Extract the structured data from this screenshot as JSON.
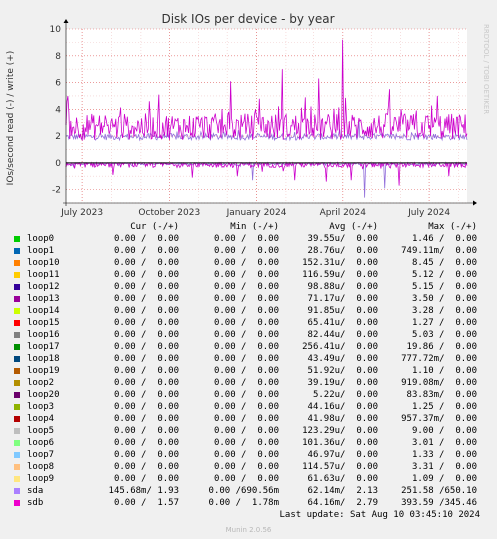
{
  "colors": {
    "background": "#f0f0f0",
    "plot_background": "#ffffff",
    "grid": "#e06060",
    "read_line": "#000000"
  },
  "chart_data": {
    "type": "line",
    "title": "Disk IOs per device - by year",
    "ylabel": "IOs/second read (-) / write (+)",
    "ylim": [
      -3,
      10
    ],
    "yticks": [
      -2,
      0,
      2,
      4,
      6,
      8,
      10
    ],
    "xlim": [
      "2023-06-14",
      "2024-08-10"
    ],
    "xtick_labels": [
      {
        "label": "July 2023",
        "date": "2023-07-01"
      },
      {
        "label": "October 2023",
        "date": "2023-10-01"
      },
      {
        "label": "January 2024",
        "date": "2024-01-01"
      },
      {
        "label": "April 2024",
        "date": "2024-04-01"
      },
      {
        "label": "July 2024",
        "date": "2024-07-01"
      }
    ],
    "grid": true,
    "series": [
      {
        "name": "sdb",
        "color": "#cc00cc",
        "write_baseline": 2.7,
        "write_noise": 1.0,
        "write_spikes": [
          [
            "2023-06-15",
            4.6
          ],
          [
            "2023-09-20",
            5.1
          ],
          [
            "2023-12-05",
            6.1
          ],
          [
            "2024-01-28",
            7.0
          ],
          [
            "2024-03-07",
            6.3
          ],
          [
            "2024-04-01",
            9.2
          ],
          [
            "2024-05-20",
            5.5
          ],
          [
            "2024-07-10",
            5.0
          ]
        ],
        "read_baseline": -0.1,
        "read_noise": 0.25,
        "read_spikes": [
          [
            "2023-08-02",
            -0.9
          ],
          [
            "2023-10-25",
            -1.1
          ],
          [
            "2023-12-12",
            -1.0
          ],
          [
            "2024-02-10",
            -1.3
          ],
          [
            "2024-03-15",
            -1.4
          ],
          [
            "2024-04-10",
            -1.3
          ],
          [
            "2024-05-30",
            -1.7
          ],
          [
            "2024-07-22",
            -1.0
          ]
        ]
      },
      {
        "name": "sda",
        "color": "#9370db",
        "write_baseline": 1.95,
        "write_noise": 0.25,
        "write_spikes": [
          [
            "2024-04-18",
            3.2
          ]
        ],
        "read_baseline": -0.05,
        "read_noise": 0.1,
        "read_spikes": [
          [
            "2023-12-28",
            -1.3
          ],
          [
            "2024-04-24",
            -2.6
          ],
          [
            "2024-05-15",
            -1.9
          ]
        ]
      }
    ]
  },
  "title_right_vertical": "RRDTOOL / TOBI OETIKER",
  "legend": {
    "headers": [
      "Cur (-/+)",
      "Min (-/+)",
      "Avg (-/+)",
      "Max (-/+)"
    ],
    "rows": [
      {
        "name": "loop0",
        "color": "#00cc00",
        "cur": "0.00 /  0.00",
        "min": "0.00 /  0.00",
        "avg": "39.55u/  0.00",
        "max": "1.46 /  0.00"
      },
      {
        "name": "loop1",
        "color": "#0066b3",
        "cur": "0.00 /  0.00",
        "min": "0.00 /  0.00",
        "avg": "28.76u/  0.00",
        "max": "749.11m/  0.00"
      },
      {
        "name": "loop10",
        "color": "#ff8000",
        "cur": "0.00 /  0.00",
        "min": "0.00 /  0.00",
        "avg": "152.31u/  0.00",
        "max": "8.45 /  0.00"
      },
      {
        "name": "loop11",
        "color": "#ffcc00",
        "cur": "0.00 /  0.00",
        "min": "0.00 /  0.00",
        "avg": "116.59u/  0.00",
        "max": "5.12 /  0.00"
      },
      {
        "name": "loop12",
        "color": "#330099",
        "cur": "0.00 /  0.00",
        "min": "0.00 /  0.00",
        "avg": "98.88u/  0.00",
        "max": "5.15 /  0.00"
      },
      {
        "name": "loop13",
        "color": "#990099",
        "cur": "0.00 /  0.00",
        "min": "0.00 /  0.00",
        "avg": "71.17u/  0.00",
        "max": "3.50 /  0.00"
      },
      {
        "name": "loop14",
        "color": "#ccff00",
        "cur": "0.00 /  0.00",
        "min": "0.00 /  0.00",
        "avg": "91.85u/  0.00",
        "max": "3.28 /  0.00"
      },
      {
        "name": "loop15",
        "color": "#ff0000",
        "cur": "0.00 /  0.00",
        "min": "0.00 /  0.00",
        "avg": "65.41u/  0.00",
        "max": "1.27 /  0.00"
      },
      {
        "name": "loop16",
        "color": "#808080",
        "cur": "0.00 /  0.00",
        "min": "0.00 /  0.00",
        "avg": "82.44u/  0.00",
        "max": "5.03 /  0.00"
      },
      {
        "name": "loop17",
        "color": "#008f00",
        "cur": "0.00 /  0.00",
        "min": "0.00 /  0.00",
        "avg": "256.41u/  0.00",
        "max": "19.86 /  0.00"
      },
      {
        "name": "loop18",
        "color": "#00487d",
        "cur": "0.00 /  0.00",
        "min": "0.00 /  0.00",
        "avg": "43.49u/  0.00",
        "max": "777.72m/  0.00"
      },
      {
        "name": "loop19",
        "color": "#b35a00",
        "cur": "0.00 /  0.00",
        "min": "0.00 /  0.00",
        "avg": "51.92u/  0.00",
        "max": "1.10 /  0.00"
      },
      {
        "name": "loop2",
        "color": "#b38f00",
        "cur": "0.00 /  0.00",
        "min": "0.00 /  0.00",
        "avg": "39.19u/  0.00",
        "max": "919.08m/  0.00"
      },
      {
        "name": "loop20",
        "color": "#6b006b",
        "cur": "0.00 /  0.00",
        "min": "0.00 /  0.00",
        "avg": "5.22u/  0.00",
        "max": "83.83m/  0.00"
      },
      {
        "name": "loop3",
        "color": "#8fb300",
        "cur": "0.00 /  0.00",
        "min": "0.00 /  0.00",
        "avg": "44.16u/  0.00",
        "max": "1.25 /  0.00"
      },
      {
        "name": "loop4",
        "color": "#b30000",
        "cur": "0.00 /  0.00",
        "min": "0.00 /  0.00",
        "avg": "41.98u/  0.00",
        "max": "957.37m/  0.00"
      },
      {
        "name": "loop5",
        "color": "#bebebe",
        "cur": "0.00 /  0.00",
        "min": "0.00 /  0.00",
        "avg": "123.29u/  0.00",
        "max": "9.00 /  0.00"
      },
      {
        "name": "loop6",
        "color": "#80ff80",
        "cur": "0.00 /  0.00",
        "min": "0.00 /  0.00",
        "avg": "101.36u/  0.00",
        "max": "3.01 /  0.00"
      },
      {
        "name": "loop7",
        "color": "#80c9ff",
        "cur": "0.00 /  0.00",
        "min": "0.00 /  0.00",
        "avg": "46.97u/  0.00",
        "max": "1.33 /  0.00"
      },
      {
        "name": "loop8",
        "color": "#ffc080",
        "cur": "0.00 /  0.00",
        "min": "0.00 /  0.00",
        "avg": "114.57u/  0.00",
        "max": "3.31 /  0.00"
      },
      {
        "name": "loop9",
        "color": "#ffe680",
        "cur": "0.00 /  0.00",
        "min": "0.00 /  0.00",
        "avg": "61.63u/  0.00",
        "max": "1.09 /  0.00"
      },
      {
        "name": "sda",
        "color": "#aa80ff",
        "cur": "145.68m/ 1.93",
        "min": "0.00 /690.56m",
        "avg": "62.14m/  2.13",
        "max": "251.58 /650.10"
      },
      {
        "name": "sdb",
        "color": "#ee00cc",
        "cur": "0.00 /  1.57",
        "min": "0.00 /  1.78m",
        "avg": "64.16m/  2.79",
        "max": "393.59 /345.46"
      }
    ]
  },
  "footer": {
    "last_update": "Last update: Sat Aug 10 03:45:10 2024",
    "generator": "Munin 2.0.56"
  }
}
